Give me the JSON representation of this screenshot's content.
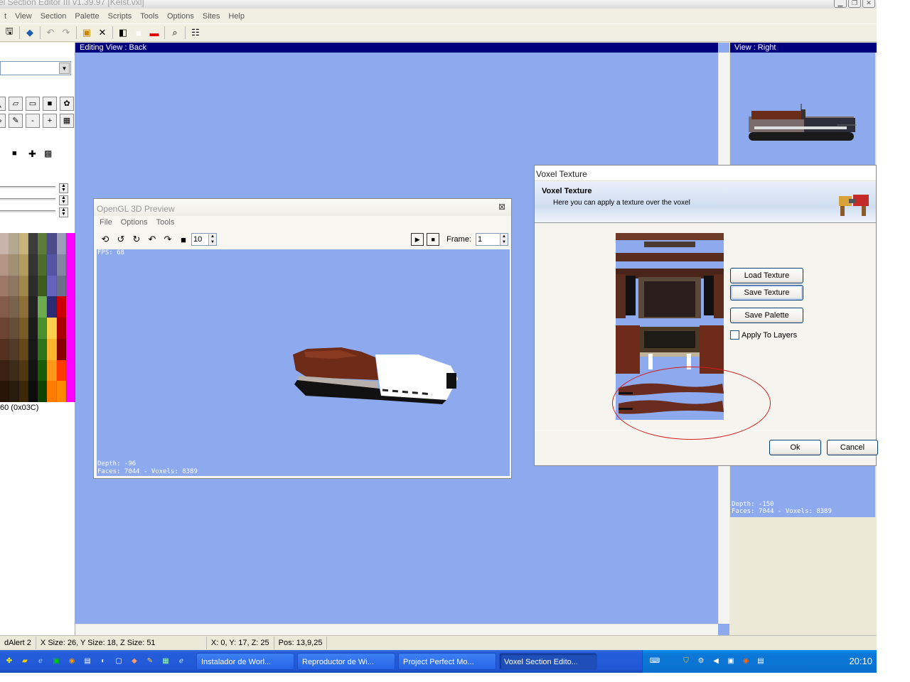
{
  "window": {
    "title": "el Section Editor III v1.39.97 [Kelst.vxl]"
  },
  "menu": [
    "t",
    "View",
    "Section",
    "Palette",
    "Scripts",
    "Tools",
    "Options",
    "Sites",
    "Help"
  ],
  "editing_view": {
    "title": "Editing View : Back"
  },
  "right_view": {
    "title": "View : Right",
    "depth": "Depth: -150",
    "faces": "Faces: 7044 - Voxels: 8389"
  },
  "left_panel": {
    "palette_label": "60 (0x03C)"
  },
  "gl_preview": {
    "title": "OpenGL 3D Preview",
    "menu": [
      "File",
      "Options",
      "Tools"
    ],
    "speed": "10",
    "frame_label": "Frame:",
    "frame": "1",
    "fps": "FPS: 68",
    "depth": "Depth: -96",
    "faces": "Faces: 7044 - Voxels: 8389"
  },
  "texture_dialog": {
    "title": "Voxel Texture",
    "heading": "Voxel Texture",
    "subtitle": "Here you can apply a texture over the voxel",
    "load_texture": "Load Texture",
    "save_texture": "Save Texture",
    "save_palette": "Save Palette",
    "apply_to_layers": "Apply To Layers",
    "ok": "Ok",
    "cancel": "Cancel"
  },
  "status": [
    "dAlert 2",
    "X Size: 26, Y Size: 18, Z Size: 51",
    "X: 0, Y: 17, Z: 25",
    "Pos: 13,9,25"
  ],
  "taskbar": {
    "tasks": [
      "Instalador de Worl...",
      "Reproductor de Wi...",
      "Project Perfect Mo...",
      "Voxel Section Edito..."
    ],
    "clock": "20:10"
  },
  "colors": {
    "view_bg": "#8eaaee",
    "header_bg": "#00007d",
    "highlight": "#d21c1c"
  }
}
